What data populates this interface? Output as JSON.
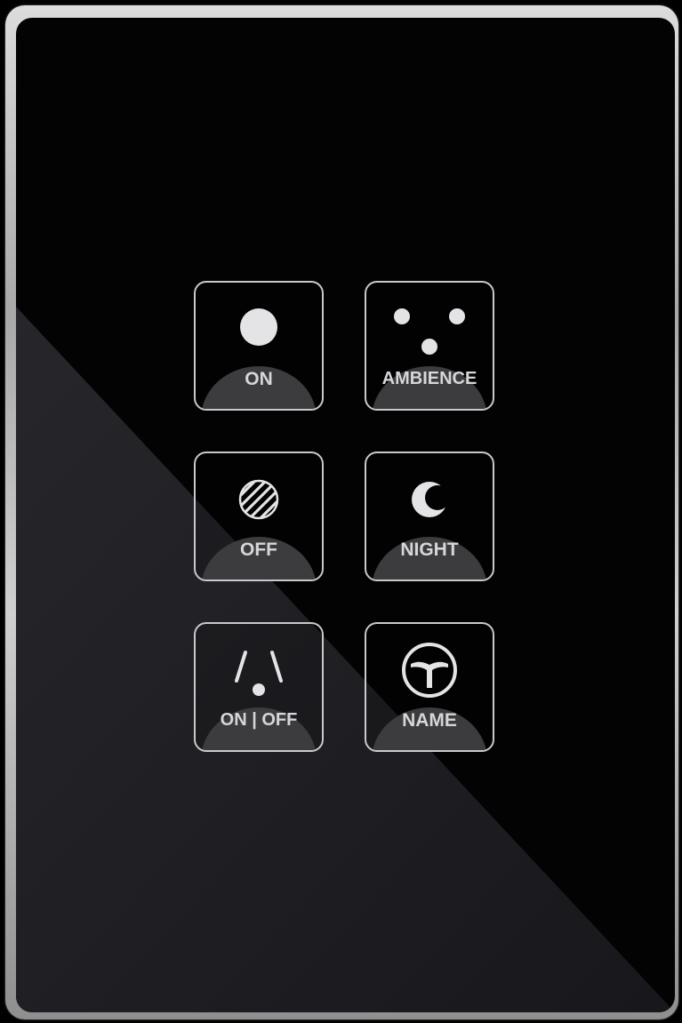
{
  "panel": {
    "colors": {
      "glass": "#030304",
      "frame": "#c0c0c0",
      "icon": "#e4e4e6",
      "label": "#d6d6d8",
      "key_border": "#c9c9cc"
    },
    "keys": [
      {
        "label": "ON",
        "icon": "filled-circle-icon"
      },
      {
        "label": "AMBIENCE",
        "icon": "three-dots-icon"
      },
      {
        "label": "OFF",
        "icon": "hatched-circle-icon"
      },
      {
        "label": "NIGHT",
        "icon": "crescent-moon-icon"
      },
      {
        "label": "ON | OFF",
        "icon": "lamp-light-icon"
      },
      {
        "label": "NAME",
        "icon": "ceiling-fan-icon"
      }
    ]
  }
}
